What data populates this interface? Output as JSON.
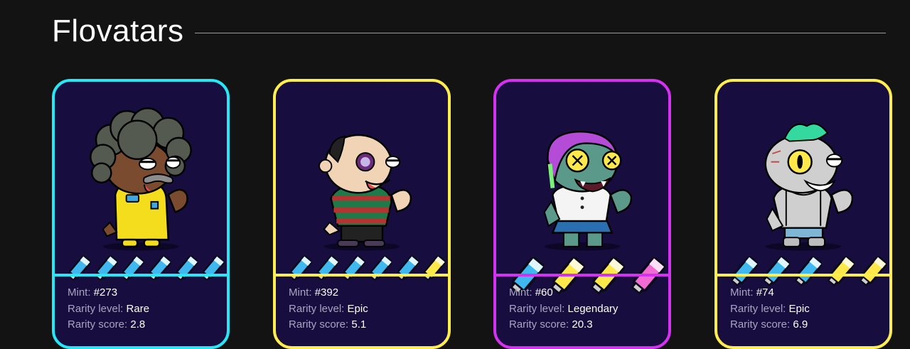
{
  "page": {
    "title": "Flovatars"
  },
  "labels": {
    "mint": "Mint: ",
    "rarity_level": "Rarity level: ",
    "rarity_score": "Rarity score: "
  },
  "colors": {
    "background": "#131313",
    "card_bg": "#170d3f",
    "rare": "#27e6f5",
    "epic": "#ffee4d",
    "legendary": "#d431f0"
  },
  "cards": [
    {
      "mint": "#273",
      "rarity_level": "Rare",
      "rarity_score": "2.8",
      "border_color": "#27e6f5",
      "character": "afro-man-yellow-jumpsuit",
      "boosters": [
        "blue",
        "blue",
        "blue",
        "blue",
        "blue",
        "blue"
      ]
    },
    {
      "mint": "#392",
      "rarity_level": "Epic",
      "rarity_score": "5.1",
      "border_color": "#ffee4d",
      "character": "bald-man-striped-sweater",
      "boosters": [
        "blue",
        "blue",
        "blue",
        "blue",
        "blue",
        "yellow"
      ]
    },
    {
      "mint": "#60",
      "rarity_level": "Legendary",
      "rarity_score": "20.3",
      "border_color": "#d431f0",
      "character": "zombie-girl-purple-hair",
      "boosters": [
        "blue",
        "yellow",
        "yellow",
        "pink"
      ]
    },
    {
      "mint": "#74",
      "rarity_level": "Epic",
      "rarity_score": "6.9",
      "border_color": "#ffee4d",
      "character": "robot-mohawk-tanktop",
      "boosters": [
        "blue",
        "blue",
        "blue",
        "yellow",
        "yellow"
      ]
    }
  ]
}
